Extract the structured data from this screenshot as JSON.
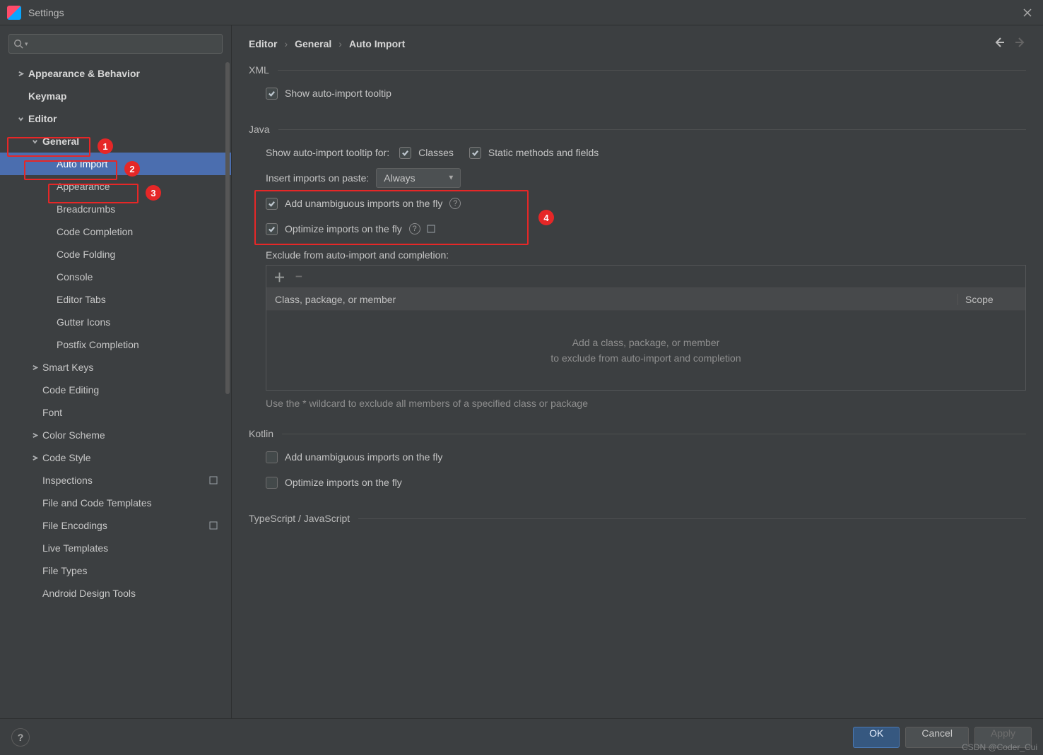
{
  "window": {
    "title": "Settings"
  },
  "search": {
    "placeholder": ""
  },
  "tree": {
    "appearance_behavior": "Appearance & Behavior",
    "keymap": "Keymap",
    "editor": "Editor",
    "general": "General",
    "auto_import": "Auto Import",
    "appearance": "Appearance",
    "breadcrumbs": "Breadcrumbs",
    "code_completion": "Code Completion",
    "code_folding": "Code Folding",
    "console": "Console",
    "editor_tabs": "Editor Tabs",
    "gutter_icons": "Gutter Icons",
    "postfix_completion": "Postfix Completion",
    "smart_keys": "Smart Keys",
    "code_editing": "Code Editing",
    "font": "Font",
    "color_scheme": "Color Scheme",
    "code_style": "Code Style",
    "inspections": "Inspections",
    "file_code_templates": "File and Code Templates",
    "file_encodings": "File Encodings",
    "live_templates": "Live Templates",
    "file_types": "File Types",
    "android_design_tools": "Android Design Tools"
  },
  "breadcrumb": {
    "a": "Editor",
    "b": "General",
    "c": "Auto Import"
  },
  "xml": {
    "section": "XML",
    "tooltip": "Show auto-import tooltip"
  },
  "java": {
    "section": "Java",
    "show_tooltip_label": "Show auto-import tooltip for:",
    "classes": "Classes",
    "static": "Static methods and fields",
    "insert_label": "Insert imports on paste:",
    "insert_value": "Always",
    "add_unambiguous": "Add unambiguous imports on the fly",
    "optimize": "Optimize imports on the fly",
    "exclude_label": "Exclude from auto-import and completion:",
    "col_class": "Class, package, or member",
    "col_scope": "Scope",
    "placeholder1": "Add a class, package, or member",
    "placeholder2": "to exclude from auto-import and completion",
    "hint": "Use the * wildcard to exclude all members of a specified class or package"
  },
  "kotlin": {
    "section": "Kotlin",
    "add_unambiguous": "Add unambiguous imports on the fly",
    "optimize": "Optimize imports on the fly"
  },
  "ts": {
    "section": "TypeScript / JavaScript"
  },
  "buttons": {
    "ok": "OK",
    "cancel": "Cancel",
    "apply": "Apply"
  },
  "badges": {
    "b1": "1",
    "b2": "2",
    "b3": "3",
    "b4": "4"
  },
  "watermark": "CSDN @Coder_Cui"
}
